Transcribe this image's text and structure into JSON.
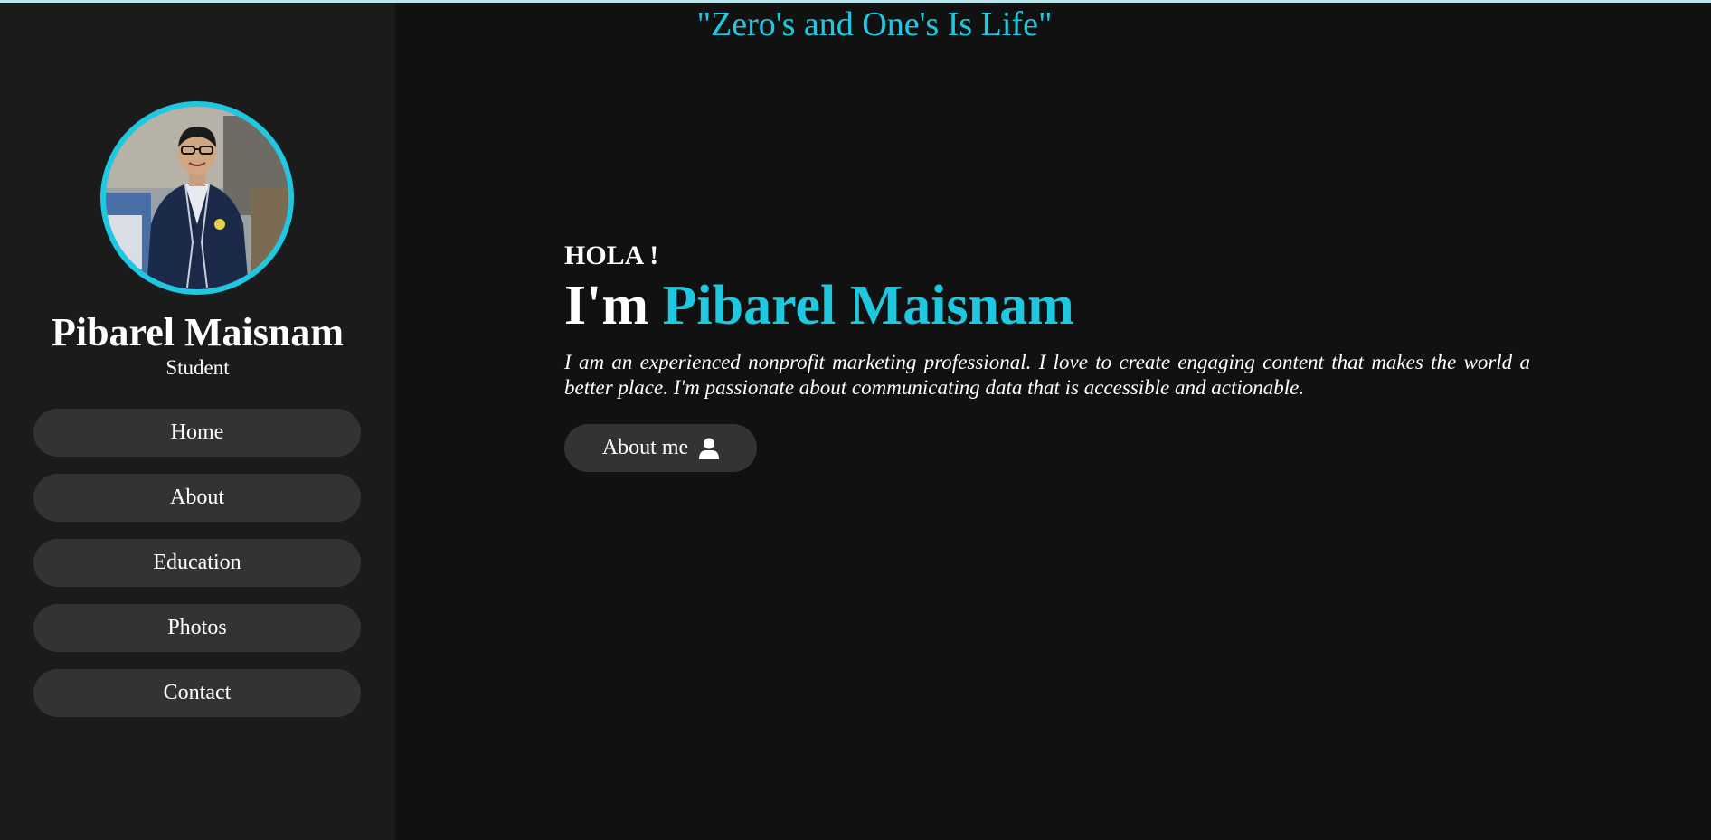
{
  "header": {
    "quote": "\"Zero's and One's Is Life\""
  },
  "sidebar": {
    "profile": {
      "name": "Pibarel Maisnam",
      "role": "Student",
      "avatar_icon": "profile-photo"
    },
    "nav": [
      {
        "label": "Home"
      },
      {
        "label": "About"
      },
      {
        "label": "Education"
      },
      {
        "label": "Photos"
      },
      {
        "label": "Contact"
      }
    ]
  },
  "hero": {
    "greeting": "HOLA !",
    "intro_prefix": "I'm",
    "name": "Pibarel Maisnam",
    "bio": "I am an experienced nonprofit marketing professional. I love to create engaging content that makes the world a better place. I'm passionate about communicating data that is accessible and actionable.",
    "button_label": "About me",
    "button_icon": "user-icon"
  },
  "colors": {
    "accent": "#1ec8e0",
    "background": "#111111",
    "sidebar": "#1b1b1b",
    "button": "#333333"
  }
}
